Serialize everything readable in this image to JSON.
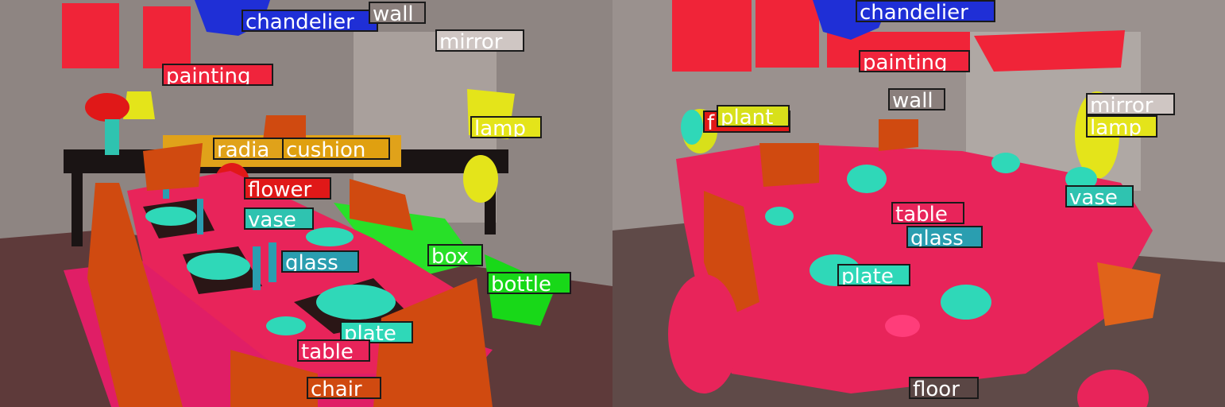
{
  "colors": {
    "chandelier": "#1f2fd6",
    "wall": "#8a7f7c",
    "mirror": "#cfc6c3",
    "painting": "#f0243c",
    "lamp": "#e4e41a",
    "radiator": "#e0a21a",
    "cushion": "#e0a010",
    "flower": "#e01818",
    "vase": "#2fc3b0",
    "glass": "#2a9eb0",
    "box": "#28e028",
    "bottle": "#18d818",
    "plate": "#2fd8b8",
    "table": "#e8245a",
    "chair": "#d04a10",
    "floor": "#5a4644",
    "plant": "#d8e01a"
  },
  "left_panel": {
    "labels": {
      "chandelier": "chandelier",
      "wall": "wall",
      "mirror": "mirror",
      "painting": "painting",
      "lamp": "lamp",
      "radiator": "radia",
      "cushion": "cushion",
      "flower": "flower",
      "vase": "vase",
      "glass": "glass",
      "box": "box",
      "bottle": "bottle",
      "plate": "plate",
      "table": "table",
      "chair": "chair"
    }
  },
  "right_panel": {
    "labels": {
      "chandelier": "chandelier",
      "painting": "painting",
      "wall": "wall",
      "flower": "f",
      "plant": "plant",
      "mirror": "mirror",
      "lamp": "lamp",
      "vase": "vase",
      "table": "table",
      "glass": "glass",
      "plate": "plate",
      "floor": "floor"
    }
  }
}
